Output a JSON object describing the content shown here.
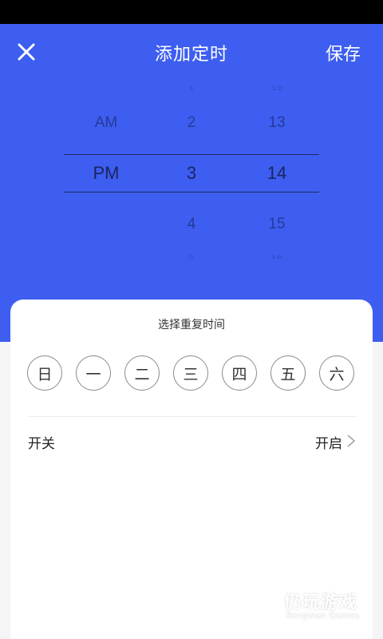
{
  "header": {
    "title": "添加定时",
    "save_label": "保存",
    "close_icon": "close-icon"
  },
  "picker": {
    "ampm": {
      "above": "AM",
      "selected": "PM"
    },
    "hour": {
      "faint_above": "1",
      "above": "2",
      "selected": "3",
      "below": "4",
      "faint_below": "5"
    },
    "minute": {
      "faint_above": "12",
      "above": "13",
      "selected": "14",
      "below": "15",
      "faint_below": "16"
    }
  },
  "repeat": {
    "title": "选择重复时间",
    "days": [
      "日",
      "一",
      "二",
      "三",
      "四",
      "五",
      "六"
    ]
  },
  "switch_row": {
    "label": "开关",
    "value": "开启",
    "chevron_icon": "chevron-right-icon"
  },
  "watermark": {
    "brand": "仍玩游戏",
    "sub": "Rengwan Games"
  },
  "colors": {
    "primary": "#3d5ef0",
    "status_bar": "#000000",
    "card": "#ffffff"
  }
}
